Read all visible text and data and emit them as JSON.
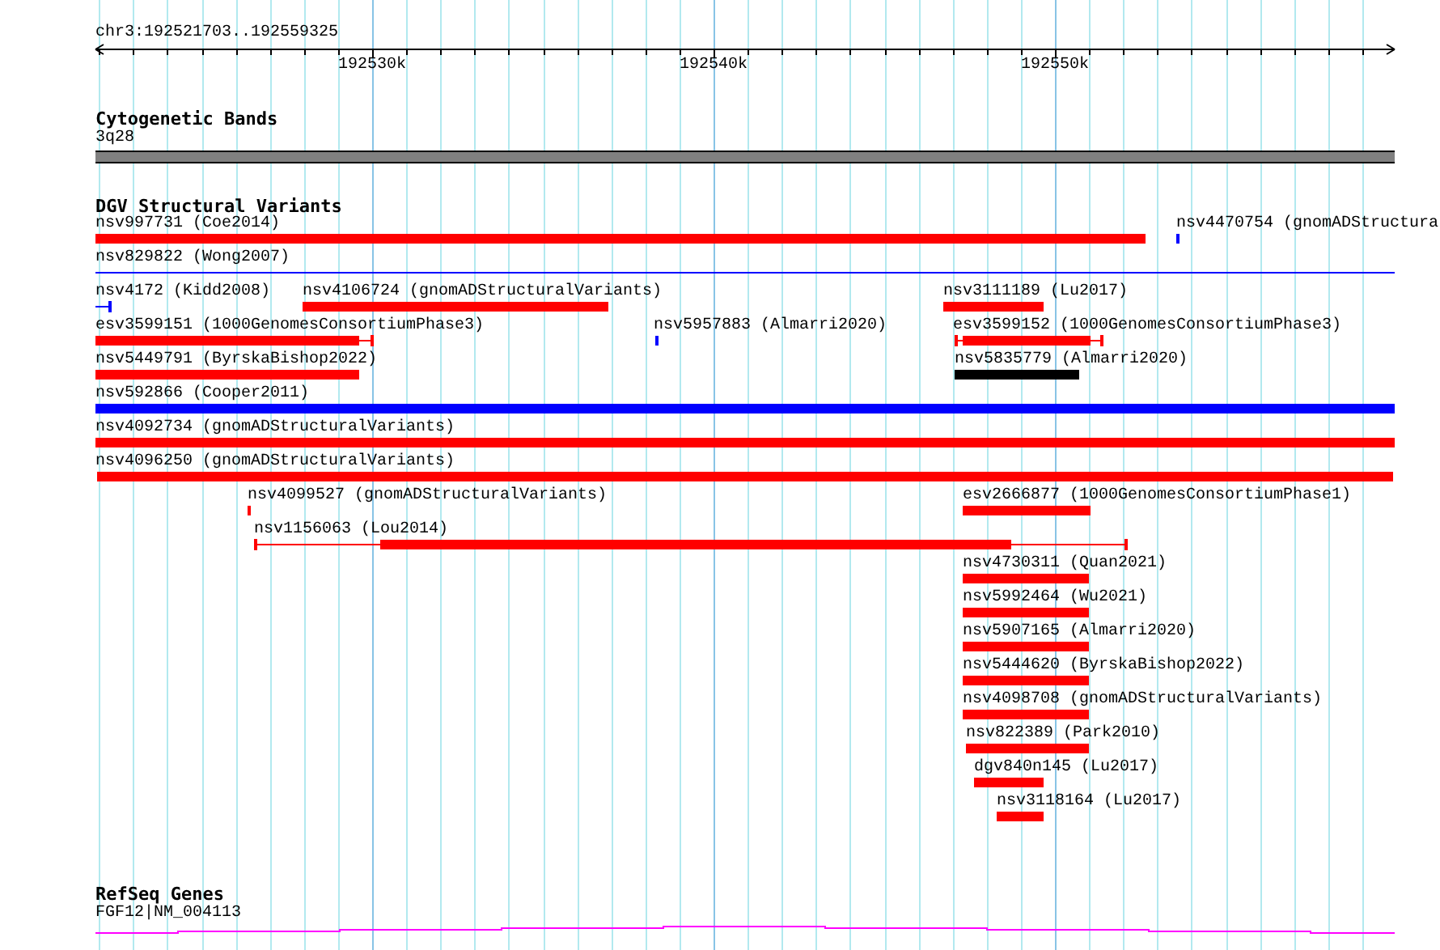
{
  "ruler": {
    "location": "chr3:192521703..192559325",
    "ticks": [
      "192530k",
      "192540k",
      "192550k"
    ]
  },
  "cytobands": {
    "title": "Cytogenetic Bands",
    "label": "3q28"
  },
  "variants": {
    "title": "DGV Structural Variants",
    "features": [
      {
        "label": "nsv997731 (Coe2014)",
        "color": "#ff0000"
      },
      {
        "label": "nsv4470754 (gnomADStructura",
        "color": "#0000ff"
      },
      {
        "label": "nsv829822 (Wong2007)",
        "color": "#0000ff"
      },
      {
        "label": "nsv4172 (Kidd2008)",
        "color": "#0000ff"
      },
      {
        "label": "nsv4106724 (gnomADStructuralVariants)",
        "color": "#ff0000"
      },
      {
        "label": "nsv3111189 (Lu2017)",
        "color": "#ff0000"
      },
      {
        "label": "esv3599151 (1000GenomesConsortiumPhase3)",
        "color": "#ff0000"
      },
      {
        "label": "nsv5957883 (Almarri2020)",
        "color": "#0000ff"
      },
      {
        "label": "esv3599152 (1000GenomesConsortiumPhase3)",
        "color": "#ff0000"
      },
      {
        "label": "nsv5449791 (ByrskaBishop2022)",
        "color": "#ff0000"
      },
      {
        "label": "nsv5835779 (Almarri2020)",
        "color": "#000000"
      },
      {
        "label": "nsv592866 (Cooper2011)",
        "color": "#0000ff"
      },
      {
        "label": "nsv4092734 (gnomADStructuralVariants)",
        "color": "#ff0000"
      },
      {
        "label": "nsv4096250 (gnomADStructuralVariants)",
        "color": "#ff0000"
      },
      {
        "label": "nsv4099527 (gnomADStructuralVariants)",
        "color": "#ff0000"
      },
      {
        "label": "esv2666877 (1000GenomesConsortiumPhase1)",
        "color": "#ff0000"
      },
      {
        "label": "nsv1156063 (Lou2014)",
        "color": "#ff0000"
      },
      {
        "label": "nsv4730311 (Quan2021)",
        "color": "#ff0000"
      },
      {
        "label": "nsv5992464 (Wu2021)",
        "color": "#ff0000"
      },
      {
        "label": "nsv5907165 (Almarri2020)",
        "color": "#ff0000"
      },
      {
        "label": "nsv5444620 (ByrskaBishop2022)",
        "color": "#ff0000"
      },
      {
        "label": "nsv4098708 (gnomADStructuralVariants)",
        "color": "#ff0000"
      },
      {
        "label": "nsv822389 (Park2010)",
        "color": "#ff0000"
      },
      {
        "label": "dgv840n145 (Lu2017)",
        "color": "#ff0000"
      },
      {
        "label": "nsv3118164 (Lu2017)",
        "color": "#ff0000"
      }
    ]
  },
  "genes": {
    "title": "RefSeq Genes",
    "label": "FGF12|NM_004113"
  }
}
